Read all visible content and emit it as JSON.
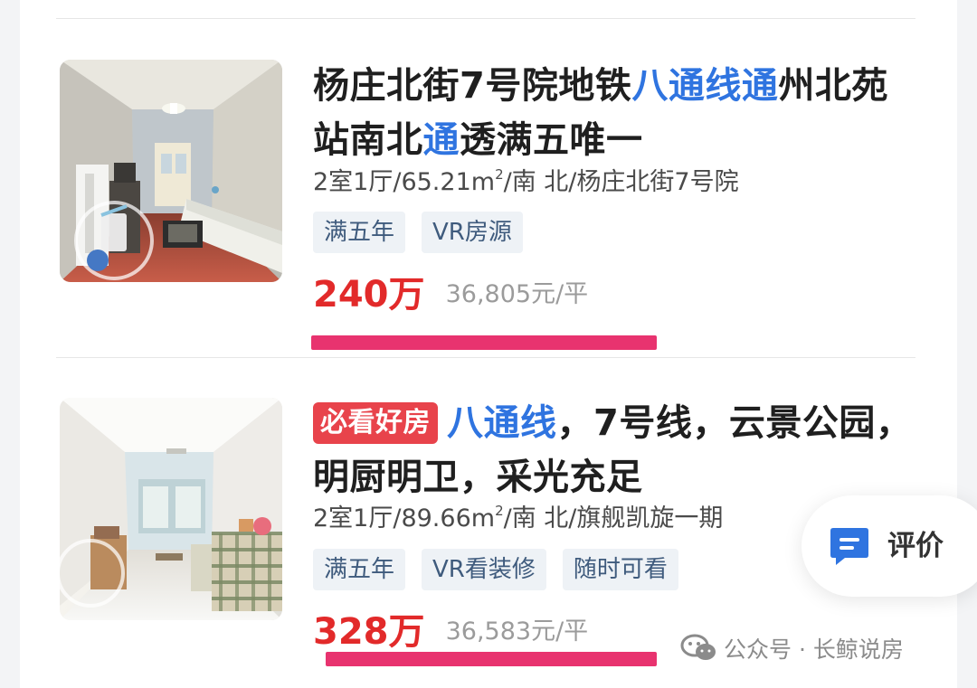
{
  "listings": [
    {
      "title_parts": [
        "杨庄北街7号院地铁",
        "八通线通",
        "州北苑站南北",
        "通",
        "透满五唯一"
      ],
      "summary_parts": [
        "2室1厅/65.21m",
        "2",
        "/南 北/杨庄北街7号院"
      ],
      "tags": [
        "满五年",
        "VR房源"
      ],
      "price": "240万",
      "unit_price": "36,805元/平",
      "image_icon": "living-room-photo"
    },
    {
      "badge": "必看好房",
      "title_parts": [
        "八通线",
        "，7号线，云景公园，明厨明卫，采光充足"
      ],
      "summary_parts": [
        "2室1厅/89.66m",
        "2",
        "/南 北/旗舰凯旋一期"
      ],
      "tags": [
        "满五年",
        "VR看装修",
        "随时可看"
      ],
      "price": "328万",
      "unit_price": "36,583元/平",
      "image_icon": "bright-living-room-photo"
    }
  ],
  "review_button": {
    "label": "评价",
    "icon": "comment-icon"
  },
  "watermark": {
    "text": "公众号 · 长鲸说房",
    "icon": "wechat-icon"
  },
  "colors": {
    "accent": "#2f74e0",
    "price": "#e22a2a",
    "badge": "#e8434b",
    "annotation": "#e8336f",
    "tag_bg": "#eef2f6"
  }
}
